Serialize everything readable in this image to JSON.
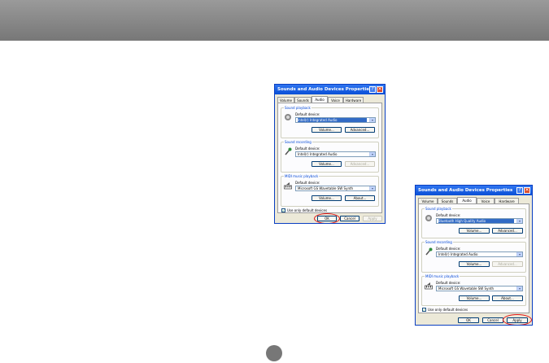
{
  "dialog": {
    "title": "Sounds and Audio Devices Properties",
    "help_symbol": "?",
    "close_symbol": "✕",
    "tabs": [
      "Volume",
      "Sounds",
      "Audio",
      "Voice",
      "Hardware"
    ],
    "active_tab": "Audio",
    "groups": {
      "playback": {
        "label": "Sound playback",
        "default_label": "Default device:",
        "icon": "speaker-icon"
      },
      "recording": {
        "label": "Sound recording",
        "default_label": "Default device:",
        "icon": "microphone-icon"
      },
      "midi": {
        "label": "MIDI music playback",
        "default_label": "Default device:",
        "icon": "keyboard-icon"
      }
    },
    "buttons": {
      "volume": "Volume...",
      "advanced": "Advanced...",
      "about": "About...",
      "ok": "OK",
      "cancel": "Cancel",
      "apply": "Apply"
    },
    "checkbox": {
      "label": "Use only default devices",
      "checked": true
    },
    "dropdown_arrow": "▾"
  },
  "dialog_left": {
    "playback_device": "Intel(r) Integrated Audio",
    "recording_device": "Intel(r) Integrated Audio",
    "midi_device": "Microsoft GS Wavetable SW Synth",
    "highlighted_button": "OK"
  },
  "dialog_right": {
    "playback_device": "Bluetooth High Quality Audio",
    "recording_device": "Intel(r) Integrated Audio",
    "midi_device": "Microsoft GS Wavetable SW Synth",
    "highlighted_button": "Apply"
  },
  "colors": {
    "highlight_ring": "#e01515",
    "titlebar": "#0a4fd6",
    "header_bar": "#8a8a8a"
  }
}
